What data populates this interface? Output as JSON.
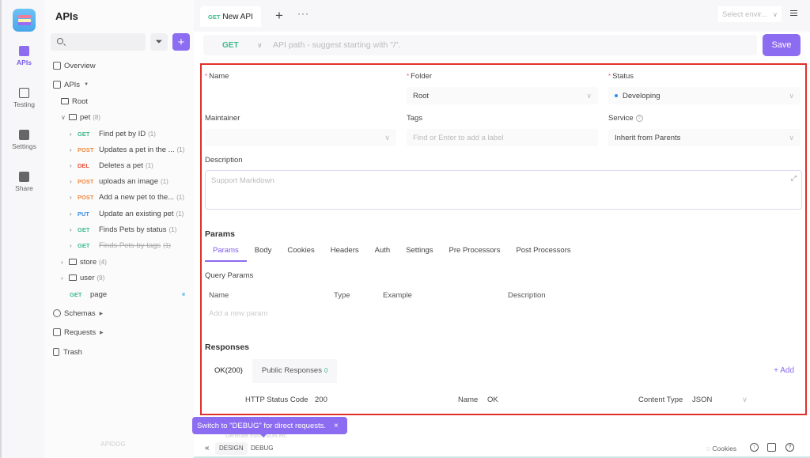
{
  "rail": {
    "items": [
      {
        "label": "APIs",
        "icon": "apis-icon",
        "active": true
      },
      {
        "label": "Testing",
        "icon": "testing-icon"
      },
      {
        "label": "Settings",
        "icon": "settings-icon"
      },
      {
        "label": "Share",
        "icon": "share-icon"
      }
    ]
  },
  "sidebar": {
    "title": "APIs",
    "search_placeholder": "",
    "overview": "Overview",
    "apis": "APIs",
    "root": "Root",
    "pet": {
      "label": "pet",
      "count": "(8)"
    },
    "endpoints": [
      {
        "method": "GET",
        "name": "Find pet by ID",
        "count": "(1)"
      },
      {
        "method": "POST",
        "name": "Updates a pet in the ...",
        "count": "(1)"
      },
      {
        "method": "DEL",
        "name": "Deletes a pet",
        "count": "(1)"
      },
      {
        "method": "POST",
        "name": "uploads an image",
        "count": "(1)"
      },
      {
        "method": "POST",
        "name": "Add a new pet to the...",
        "count": "(1)"
      },
      {
        "method": "PUT",
        "name": "Update an existing pet",
        "count": "(1)"
      },
      {
        "method": "GET",
        "name": "Finds Pets by status",
        "count": "(1)"
      },
      {
        "method": "GET",
        "name": "Finds Pets by tags",
        "count": "(1)",
        "deprecated": true
      }
    ],
    "store": {
      "label": "store",
      "count": "(4)"
    },
    "user": {
      "label": "user",
      "count": "(9)"
    },
    "page": {
      "method": "GET",
      "name": "page"
    },
    "schemas": "Schemas",
    "requests": "Requests",
    "trash": "Trash",
    "brand": "APIDOG"
  },
  "tabbar": {
    "tab": {
      "method": "GET",
      "label": "New API"
    },
    "plus": "+",
    "more": "···",
    "env_placeholder": "Select envir...",
    "env_chevron": "∨"
  },
  "urlbar": {
    "method": "GET",
    "chevron": "∨",
    "placeholder": "API path - suggest starting with \"/\".",
    "save": "Save"
  },
  "form": {
    "name_label": "Name",
    "folder_label": "Folder",
    "folder_value": "Root",
    "status_label": "Status",
    "status_value": "Developing",
    "status_color": "#2b8ff0",
    "maintainer_label": "Maintainer",
    "tags_label": "Tags",
    "tags_placeholder": "Find or Enter to add a label",
    "service_label": "Service",
    "service_value": "Inherit from Parents",
    "description_label": "Description",
    "description_placeholder": "Support Markdown",
    "params_title": "Params",
    "param_tabs": [
      "Params",
      "Body",
      "Cookies",
      "Headers",
      "Auth",
      "Settings",
      "Pre Processors",
      "Post Processors"
    ],
    "query_params_label": "Query Params",
    "columns": [
      "Name",
      "Type",
      "Example",
      "Description"
    ],
    "add_param_placeholder": "Add a new param",
    "responses_title": "Responses",
    "response_tabs": [
      {
        "label": "OK(200)"
      },
      {
        "label": "Public Responses",
        "count": "0"
      }
    ],
    "add_label": "+ Add",
    "http_status_label": "HTTP Status Code",
    "http_status_value": "200",
    "resp_name_label": "Name",
    "resp_name_value": "OK",
    "content_type_label": "Content Type",
    "content_type_value": "JSON"
  },
  "bottom": {
    "toast": "Switch to \"DEBUG\" for direct requests.",
    "toast_close": "×",
    "collapse": "«",
    "design": "DESIGN",
    "debug": "DEBUG",
    "cookies": "Cookies",
    "import_hint": "Generate from JSON etc."
  },
  "colors": {
    "accent": "#8c6cf0",
    "get": "#3dbb8a",
    "post": "#f0883e",
    "delete": "#e5533c",
    "put": "#3b8ee6",
    "highlight_border": "#e0302a"
  }
}
